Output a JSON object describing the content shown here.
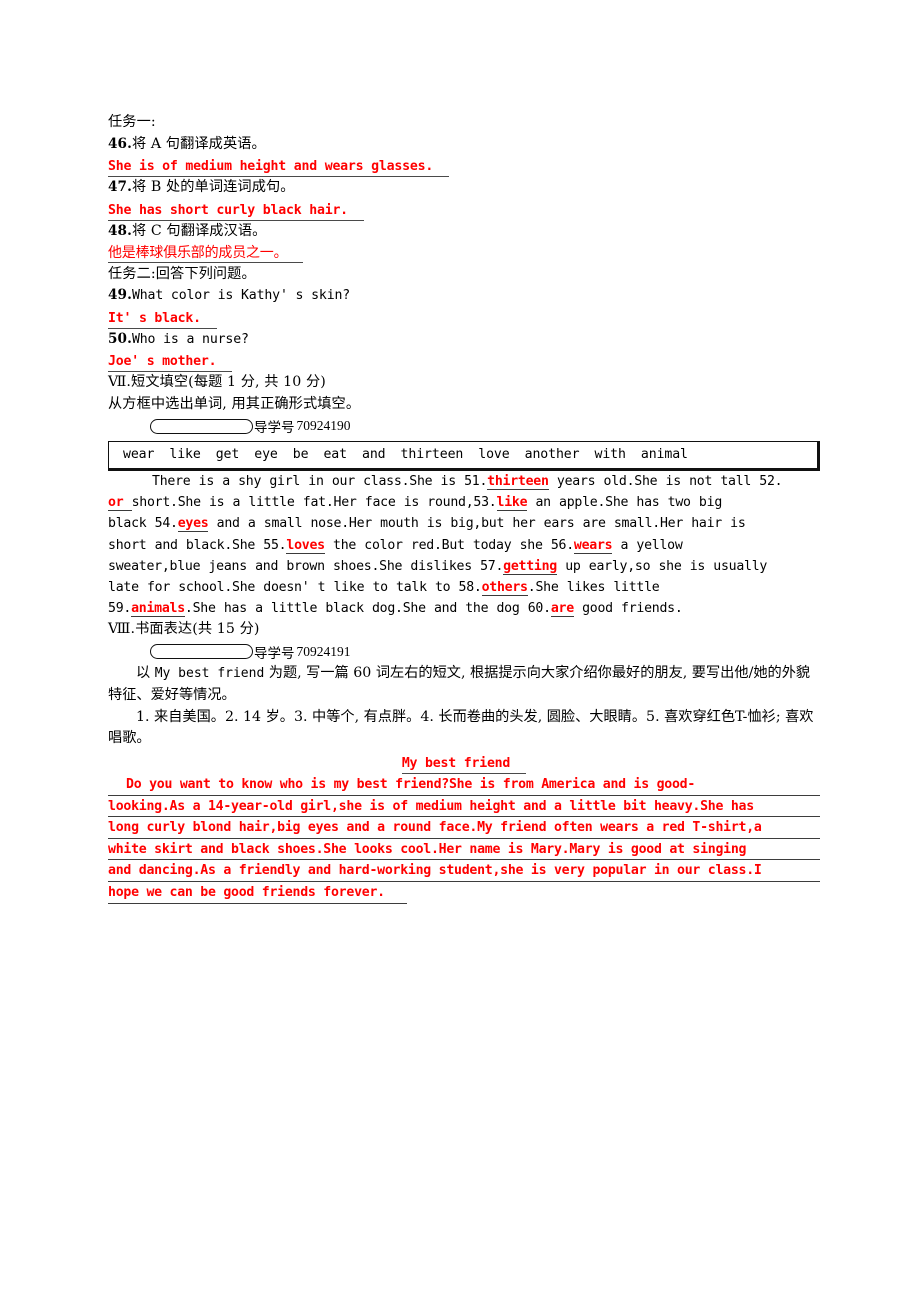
{
  "task_one": {
    "heading": "任务一:",
    "items": [
      {
        "num": "46.",
        "prompt": "将 A 句翻译成英语。",
        "answer": "She is of medium height and wears glasses.",
        "answer_lang": "en"
      },
      {
        "num": "47.",
        "prompt": "将 B 处的单词连词成句。",
        "answer": "She has short curly black hair.",
        "answer_lang": "en"
      },
      {
        "num": "48.",
        "prompt": "将 C 句翻译成汉语。",
        "answer": "他是棒球俱乐部的成员之一。",
        "answer_lang": "cn"
      }
    ]
  },
  "task_two": {
    "heading": "任务二:回答下列问题。",
    "items": [
      {
        "num": "49.",
        "prompt": "What color is Kathy' s skin?",
        "answer": "It' s black."
      },
      {
        "num": "50.",
        "prompt": "Who is a nurse?",
        "answer": "Joe' s mother."
      }
    ]
  },
  "section_seven": {
    "roman": "Ⅶ.",
    "title": "短文填空(每题 1 分, 共 10 分)",
    "instruction": "从方框中选出单词, 用其正确形式填空。",
    "tag_label": "导学号",
    "tag_number": "70924190",
    "word_bank": [
      "wear",
      "like",
      "get",
      "eye",
      "be",
      "eat",
      "and",
      "thirteen",
      "love",
      "another",
      "with",
      "animal"
    ],
    "passage_parts": [
      {
        "t": "There is a shy girl in our class.She is 51.",
        "k": "text"
      },
      {
        "t": "thirteen",
        "k": "blank"
      },
      {
        "t": " years old.She is not tall 52.",
        "k": "text"
      },
      {
        "t": "or",
        "k": "blank"
      },
      {
        "t": " short.She is a little fat.Her face is round,53.",
        "k": "text"
      },
      {
        "t": "like",
        "k": "blank"
      },
      {
        "t": " an apple.She has two big black 54.",
        "k": "text"
      },
      {
        "t": "eyes",
        "k": "blank"
      },
      {
        "t": " and a small nose.Her mouth is big,but her ears are small.Her hair is short and black.She 55.",
        "k": "text"
      },
      {
        "t": "loves",
        "k": "blank"
      },
      {
        "t": " the color red.But today she 56.",
        "k": "text"
      },
      {
        "t": "wears",
        "k": "blank"
      },
      {
        "t": " a yellow sweater,blue jeans and brown shoes.She dislikes 57.",
        "k": "text"
      },
      {
        "t": "getting",
        "k": "blank"
      },
      {
        "t": " up early,so she is usually late for school.She doesn' t like to talk to 58.",
        "k": "text"
      },
      {
        "t": "others",
        "k": "blank"
      },
      {
        "t": ".She likes little 59.",
        "k": "text"
      },
      {
        "t": "animals",
        "k": "blank"
      },
      {
        "t": ".She has a little black dog.She and the dog 60.",
        "k": "text"
      },
      {
        "t": "are",
        "k": "blank"
      },
      {
        "t": " good friends.",
        "k": "text"
      }
    ],
    "passage_lines": [
      [
        {
          "t": "There is a shy girl in our class.She is 51.",
          "k": "text"
        },
        {
          "t": "thirteen",
          "k": "blank"
        },
        {
          "t": " years old.She is not tall 52.",
          "k": "text"
        }
      ],
      [
        {
          "t": "or  ",
          "k": "blank"
        },
        {
          "t": " short.She is a little fat.Her face is round,53.",
          "k": "text"
        },
        {
          "t": "like",
          "k": "blank"
        },
        {
          "t": " an apple.She has two big",
          "k": "text"
        }
      ],
      [
        {
          "t": "black 54.",
          "k": "text"
        },
        {
          "t": "eyes",
          "k": "blank"
        },
        {
          "t": " and a small nose.Her mouth is big,but her ears are small.Her hair is",
          "k": "text"
        }
      ],
      [
        {
          "t": "short and black.She 55.",
          "k": "text"
        },
        {
          "t": "loves",
          "k": "blank"
        },
        {
          "t": " the color red.But today she 56.",
          "k": "text"
        },
        {
          "t": "wears",
          "k": "blank"
        },
        {
          "t": " a yellow",
          "k": "text"
        }
      ],
      [
        {
          "t": "sweater,blue jeans and brown shoes.She dislikes 57.",
          "k": "text"
        },
        {
          "t": "getting",
          "k": "blank"
        },
        {
          "t": " up early,so she is usually",
          "k": "text"
        }
      ],
      [
        {
          "t": "late for school.She doesn' t like to talk to 58.",
          "k": "text"
        },
        {
          "t": "others",
          "k": "blank"
        },
        {
          "t": ".She likes little",
          "k": "text"
        }
      ],
      [
        {
          "t": "59.",
          "k": "text"
        },
        {
          "t": "animals",
          "k": "blank"
        },
        {
          "t": ".She has a little black dog.She and the dog 60.",
          "k": "text"
        },
        {
          "t": "are",
          "k": "blank"
        },
        {
          "t": " good friends.",
          "k": "text"
        }
      ]
    ]
  },
  "section_eight": {
    "roman": "Ⅷ.",
    "title": "书面表达(共 15 分)",
    "tag_label": "导学号",
    "tag_number": "70924191",
    "prompt_line1_a": "以 ",
    "prompt_line1_mono": "My best friend",
    "prompt_line1_b": " 为题, 写一篇 60 词左右的短文, 根据提示向大家介绍你最好的朋友, 要写出",
    "prompt_line2": "他/她的外貌特征、爱好等情况。",
    "hints_line1": "1. 来自美国。2. 14 岁。3. 中等个, 有点胖。4. 长而卷曲的头发, 圆脸、大眼睛。5. 喜欢穿红色",
    "hints_line2": "T-恤衫; 喜欢唱歌。",
    "composition": {
      "title": "My best friend",
      "lines": [
        "Do you want to know who is my best friend?She is from America and is good-",
        "looking.As a 14-year-old girl,she is of medium height and a little bit heavy.She has",
        "long curly blond hair,big eyes and a round face.My friend often wears a red T-shirt,a",
        "white skirt and black shoes.She looks cool.Her name is Mary.Mary is good at singing",
        "and dancing.As a friendly and hard-working student,she is very popular in our class.I",
        "hope we can be good friends forever."
      ]
    }
  },
  "colors": {
    "answer_red": "#ff0000",
    "text_black": "#000000",
    "underline": "#3d3d3d"
  }
}
